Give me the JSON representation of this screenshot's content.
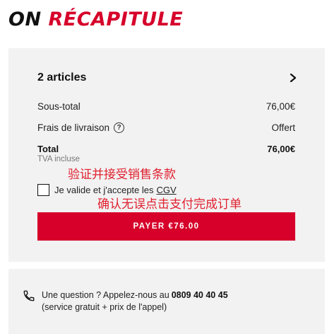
{
  "heading": {
    "part1": "ON",
    "part2": "RÉCAPITULE"
  },
  "summary": {
    "articles_label": "2 articles",
    "subtotal_label": "Sous-total",
    "subtotal_value": "76,00€",
    "delivery_label": "Frais de livraison",
    "delivery_help": "?",
    "delivery_value": "Offert",
    "total_label": "Total",
    "total_value": "76,00€",
    "tax_note": "TVA incluse"
  },
  "overlays": {
    "line1": "验证并接受销售条款",
    "line2": "确认无误点击支付完成订单"
  },
  "consent": {
    "text": "Je valide et j'accepte les",
    "link": "CGV",
    "checked": false
  },
  "pay_button": {
    "label": "PAYER €76.00"
  },
  "help": {
    "question": "Une question ? Appelez-nous au",
    "phone": "0809 40 40 45",
    "note": "(service gratuit + prix de l'appel)"
  },
  "colors": {
    "accent": "#d6002a",
    "panel_bg": "#f2f2f2"
  },
  "icons": {
    "articles_chevron": "chevron-right-icon",
    "help_phone": "phone-icon"
  }
}
